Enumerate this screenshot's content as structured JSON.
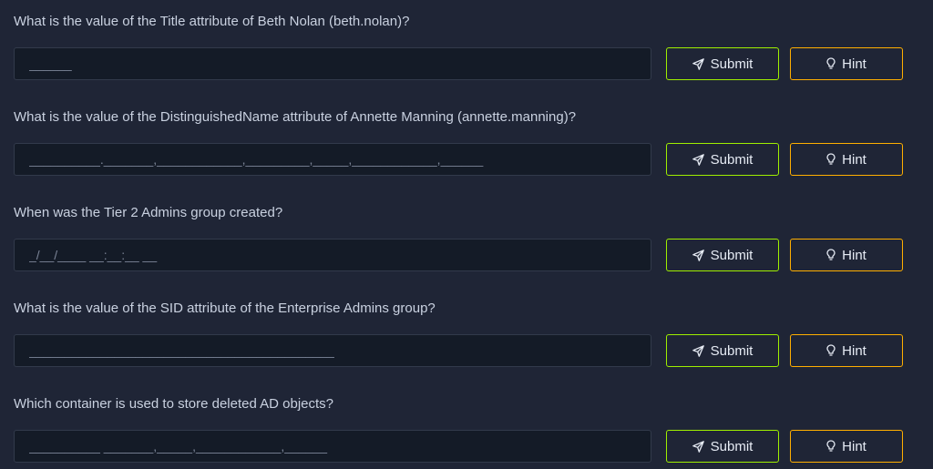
{
  "questions": [
    {
      "text": "What is the value of the Title attribute of Beth Nolan (beth.nolan)?",
      "placeholder": "______",
      "submit_label": "Submit",
      "hint_label": "Hint"
    },
    {
      "text": "What is the value of the DistinguishedName attribute of Annette Manning (annette.manning)?",
      "placeholder": "__________._______,____________,_________,_____,____________,______",
      "submit_label": "Submit",
      "hint_label": "Hint"
    },
    {
      "text": "When was the Tier 2 Admins group created?",
      "placeholder": "_/__/____ __:__:__ __",
      "submit_label": "Submit",
      "hint_label": "Hint"
    },
    {
      "text": "What is the value of the SID attribute of the Enterprise Admins group?",
      "placeholder": "___________________________________________",
      "submit_label": "Submit",
      "hint_label": "Hint"
    },
    {
      "text": "Which container is used to store deleted AD objects?",
      "placeholder": "__________ _______,_____,____________,______",
      "submit_label": "Submit",
      "hint_label": "Hint"
    }
  ],
  "icons": {
    "submit": "send-icon",
    "hint": "lightbulb-icon"
  },
  "colors": {
    "background": "#1f2536",
    "input_background": "#141b27",
    "submit_border": "#9fef00",
    "hint_border": "#ffaf00",
    "text": "#c9d1e0"
  }
}
